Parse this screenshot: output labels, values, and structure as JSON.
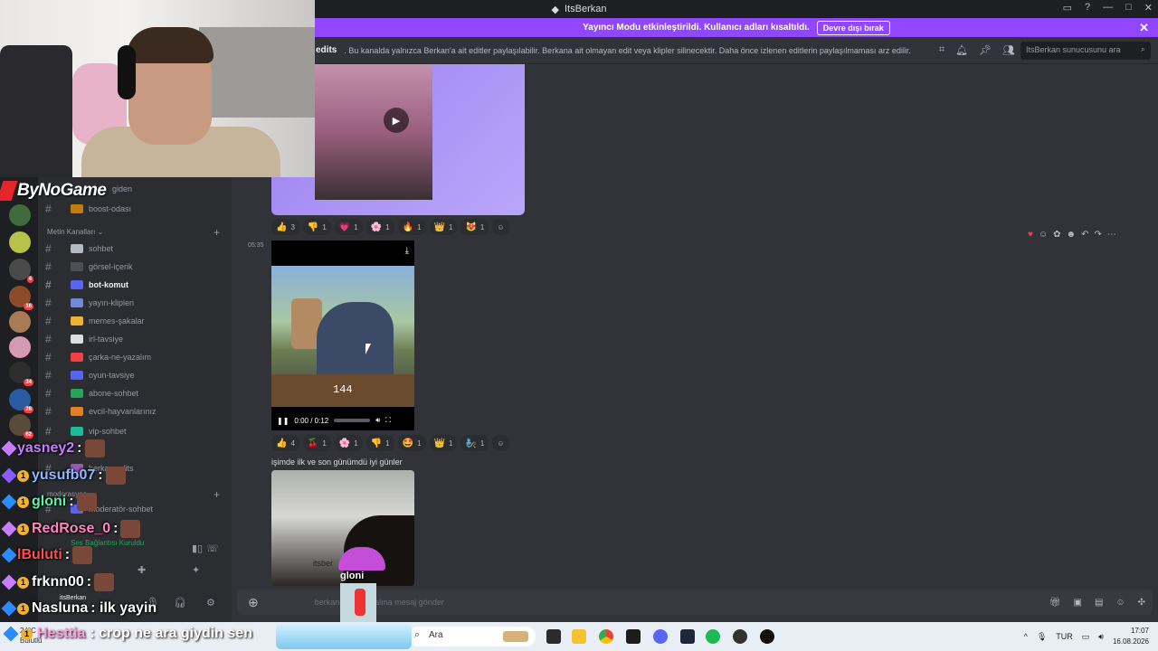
{
  "window": {
    "title": "ItsBerkan"
  },
  "streamer_banner": {
    "text": "Yayıncı Modu etkinleştirildi. Kullanıcı adları kısaltıldı.",
    "button": "Devre dışı bırak"
  },
  "channel_header": {
    "name": "edits",
    "topic": ". Bu kanalda yalnızca Berkan'a ait editler paylaşılabilir. Berkana ait olmayan edit veya klipler silinecektir. Daha önce izlenen editlerin paylaşılmaması arz edilir.",
    "search_placeholder": "ItsBerkan sunucusunu ara"
  },
  "overlay": {
    "logo": "ByNoGame"
  },
  "sidebar": {
    "partial_top": "giden",
    "category_text": "Metin Kanalları",
    "channels": [
      {
        "label": "boost-odası",
        "color": "#c27c0e"
      },
      {
        "label": "sohbet",
        "color": "#b5bac1"
      },
      {
        "label": "görsel-içerik",
        "color": "#4e5058"
      },
      {
        "label": "bot-komut",
        "color": "#5865f2"
      },
      {
        "label": "yayın-klipleri",
        "color": "#7289da"
      },
      {
        "label": "memes-şakalar",
        "color": "#f0b232"
      },
      {
        "label": "irl-tavsiye",
        "color": "#dbdee1"
      },
      {
        "label": "çarka-ne-yazalım",
        "color": "#f23f43"
      },
      {
        "label": "oyun-tavsiye",
        "color": "#5865f2"
      },
      {
        "label": "abone-sohbet",
        "color": "#23a55a"
      },
      {
        "label": "evcil-hayvanlarınız",
        "color": "#e67e22"
      },
      {
        "label": "vip-sohbet",
        "color": "#1abc9c"
      },
      {
        "label": "berkan-edits",
        "color": "#9b59b6"
      }
    ],
    "mod_category": "moderasyon",
    "mod_channel": "moderatör-sohbet",
    "voice_status": "Ses Bağlantısı Kuruldu",
    "user_tag": "itsBerkan"
  },
  "messages": {
    "timestamp": "05:35",
    "reactions_1": [
      {
        "emoji": "👍",
        "count": "3"
      },
      {
        "emoji": "👎",
        "count": "1"
      },
      {
        "emoji": "💗",
        "count": "1"
      },
      {
        "emoji": "🌸",
        "count": "1"
      },
      {
        "emoji": "🔥",
        "count": "1"
      },
      {
        "emoji": "👑",
        "count": "1"
      },
      {
        "emoji": "😻",
        "count": "1"
      }
    ],
    "reactions_2": [
      {
        "emoji": "👍",
        "count": "4"
      },
      {
        "emoji": "🍒",
        "count": "1"
      },
      {
        "emoji": "🌸",
        "count": "1"
      },
      {
        "emoji": "👎",
        "count": "1"
      },
      {
        "emoji": "🤩",
        "count": "1"
      },
      {
        "emoji": "👑",
        "count": "1"
      },
      {
        "emoji": "🧞",
        "count": "1"
      }
    ],
    "video": {
      "counter": "144",
      "time": "0:00 / 0:12"
    },
    "caption": "işimde ilk ve son günümdü iyi günler",
    "img2_text": "itsber"
  },
  "stream_chat": [
    {
      "user": "yasney2",
      "text": ":",
      "color": "#c77dff"
    },
    {
      "user": "yusufb07",
      "text": ":",
      "color": "#8fb7ff"
    },
    {
      "user": "gloni",
      "text": ":",
      "color": "#5ff0a8"
    },
    {
      "user": "RedRose_0",
      "text": ":",
      "color": "#ff85c0"
    },
    {
      "user": "lBuluti",
      "text": ":",
      "color": "#ff4d4d"
    },
    {
      "user": "frknn00",
      "text": ":",
      "color": "#ffffff"
    },
    {
      "user": "Nasluna",
      "text": ": ilk yayin",
      "color": "#ffffff"
    }
  ],
  "bottom_chat": {
    "user": "Hesttia",
    "text": ": crop ne ara giydin sen",
    "color": "#ff9de0"
  },
  "parachute": {
    "name": "gloni"
  },
  "composer": {
    "placeholder": "berkan-edits kanalına mesaj gönder"
  },
  "taskbar": {
    "search": "Ara",
    "weather_temp": "24°C",
    "weather_desc": "Bulutlu",
    "lang": "TUR",
    "time": "17:07",
    "date": "16.08.2026"
  }
}
